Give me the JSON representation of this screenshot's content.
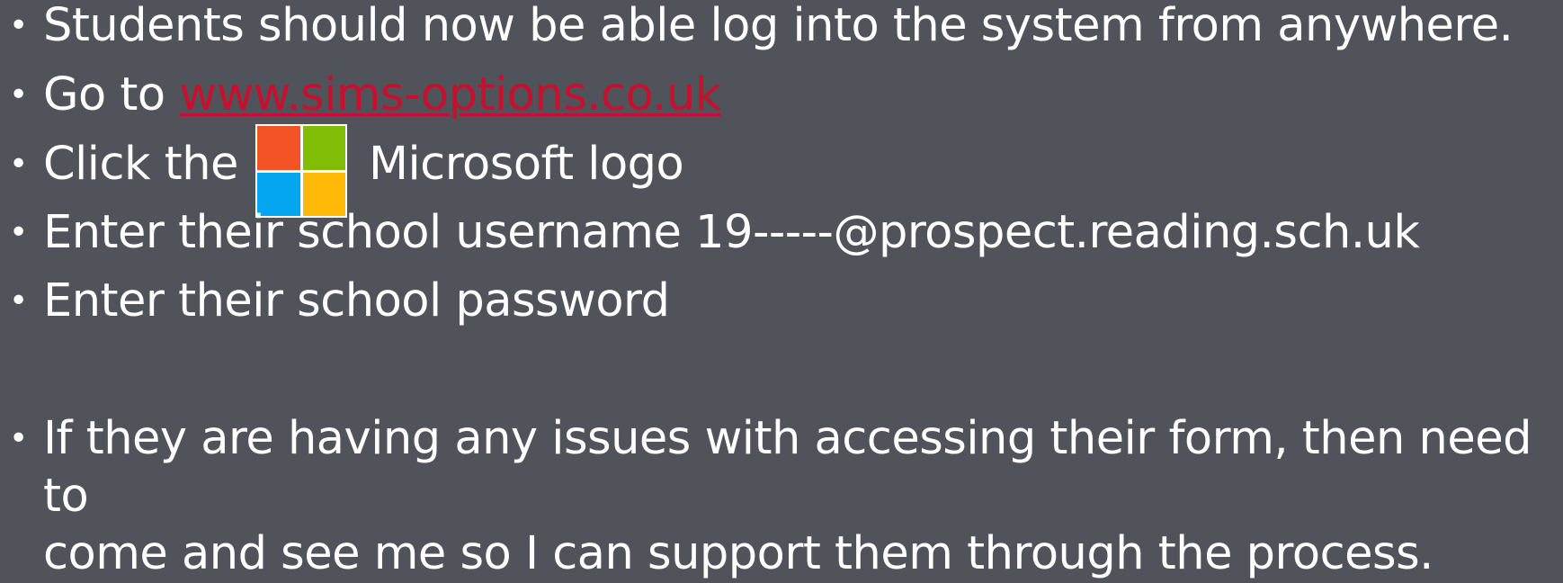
{
  "bullets": {
    "line1": "Students should now be able log into the system from anywhere.",
    "line2_prefix": "Go to ",
    "line2_link": "www.sims-options.co.uk",
    "line3_prefix": "Click the",
    "line3_suffix": "Microsoft logo",
    "line4": "Enter their school username 19-----@prospect.reading.sch.uk",
    "line5": "Enter their school password",
    "line6_a": "If they are having any issues with accessing their form, then need to",
    "line6_b": "come and see me so I can support them through the process."
  },
  "bullet_glyph": "•",
  "colors": {
    "background": "#50535a",
    "text": "#ffffff",
    "link": "#c8102e",
    "ms_red": "#f35325",
    "ms_green": "#81bc06",
    "ms_blue": "#05a6f0",
    "ms_yellow": "#ffba08"
  },
  "icons": {
    "logo": "microsoft-logo-icon"
  }
}
